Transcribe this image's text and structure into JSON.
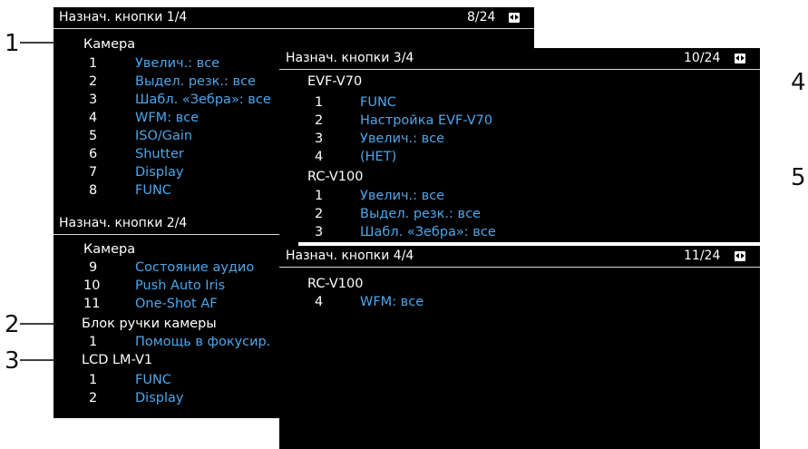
{
  "callouts": [
    "1",
    "2",
    "3",
    "4",
    "5"
  ],
  "panel1": {
    "title": "Назнач. кнопки 1/4",
    "counter": "8/24",
    "group": "Камера",
    "items": [
      {
        "num": "1",
        "label": "Увелич.: все"
      },
      {
        "num": "2",
        "label": "Выдел. резк.: все"
      },
      {
        "num": "3",
        "label": "Шабл. «Зебра»: все"
      },
      {
        "num": "4",
        "label": "WFM: все"
      },
      {
        "num": "5",
        "label": "ISO/Gain"
      },
      {
        "num": "6",
        "label": "Shutter"
      },
      {
        "num": "7",
        "label": "Display"
      },
      {
        "num": "8",
        "label": "FUNC"
      }
    ]
  },
  "panel2": {
    "title": "Назнач. кнопки 2/4",
    "group1": "Камера",
    "items1": [
      {
        "num": "9",
        "label": "Состояние аудио"
      },
      {
        "num": "10",
        "label": "Push Auto Iris"
      },
      {
        "num": "11",
        "label": "One-Shot AF"
      }
    ],
    "group2": "Блок ручки камеры",
    "items2": [
      {
        "num": "1",
        "label": "Помощь в фокусир."
      }
    ],
    "group3": "LCD LM-V1",
    "items3": [
      {
        "num": "1",
        "label": "FUNC"
      },
      {
        "num": "2",
        "label": "Display"
      }
    ]
  },
  "panel3": {
    "title": "Назнач. кнопки 3/4",
    "counter": "10/24",
    "group1": "EVF-V70",
    "items1": [
      {
        "num": "1",
        "label": "FUNC"
      },
      {
        "num": "2",
        "label": "Настройка EVF-V70"
      },
      {
        "num": "3",
        "label": "Увелич.: все"
      },
      {
        "num": "4",
        "label": "(НЕТ)"
      }
    ],
    "group2": "RC-V100",
    "items2": [
      {
        "num": "1",
        "label": "Увелич.: все"
      },
      {
        "num": "2",
        "label": "Выдел. резк.: все"
      },
      {
        "num": "3",
        "label": "Шабл. «Зебра»: все"
      }
    ]
  },
  "panel4": {
    "title": "Назнач. кнопки 4/4",
    "counter": "11/24",
    "group": "RC-V100",
    "items": [
      {
        "num": "4",
        "label": "WFM: все"
      }
    ]
  },
  "colors": {
    "screen": "#000000",
    "accent": "#4ea6ea",
    "text": "#ffffff"
  },
  "icons": {
    "arrows": "left-right-arrows-icon"
  }
}
